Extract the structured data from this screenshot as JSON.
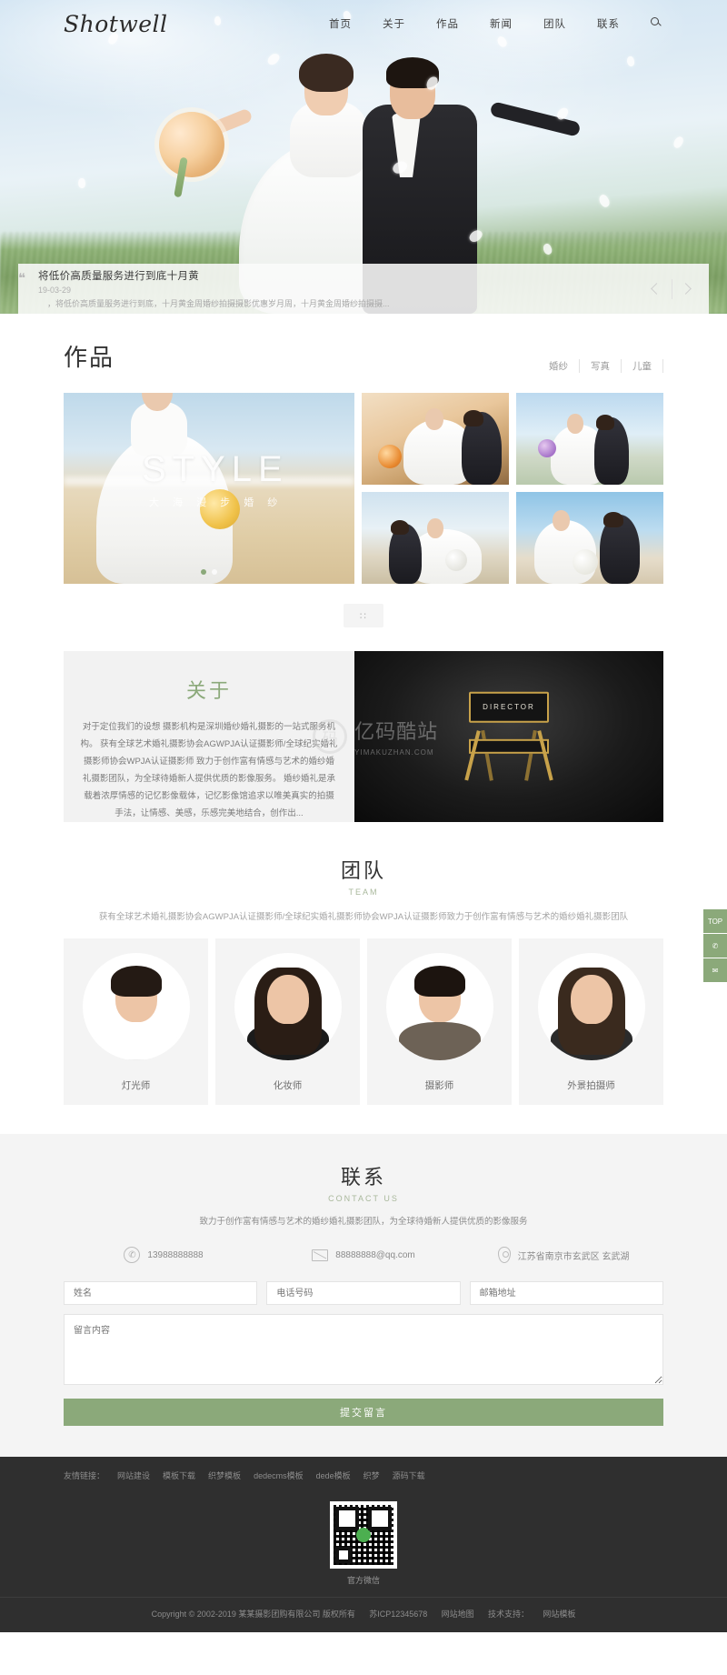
{
  "header": {
    "logo": "Shotwell",
    "nav": [
      {
        "label": "首页"
      },
      {
        "label": "关于"
      },
      {
        "label": "作品"
      },
      {
        "label": "新闻"
      },
      {
        "label": "团队"
      },
      {
        "label": "联系"
      }
    ],
    "search_icon": "search-icon"
  },
  "news": {
    "quote_mark": "❝",
    "title": "将低价高质量服务进行到底十月黄",
    "date": "19-03-29",
    "desc": "，将低价高质量服务进行到底，十月黄金周婚纱拍摄摄影优惠岁月周，十月黄金周婚纱拍摄摄...",
    "prev_label": "‹",
    "next_label": "›"
  },
  "works": {
    "title": "作品",
    "filters": [
      {
        "label": "婚纱"
      },
      {
        "label": "写真"
      },
      {
        "label": "儿童"
      }
    ],
    "slide_title": "STYLE",
    "slide_sub": "大 海 漫 步 婚 纱",
    "load_more": "∷"
  },
  "about": {
    "title": "关于",
    "text": "对于定位我们的设想 摄影机构是深圳婚纱婚礼摄影的一站式服务机构。 获有全球艺术婚礼摄影协会AGWPJA认证摄影师/全球纪实婚礼摄影师协会WPJA认证摄影师 致力于创作富有情感与艺术的婚纱婚礼摄影团队，为全球待婚新人提供优质的影像服务。 婚纱婚礼是承载着浓厚情感的记忆影像载体，记忆影像馆追求以唯美真实的拍摄手法，让情感、美感，乐感完美地结合，创作出...",
    "image_caption": "DIRECTOR",
    "watermark_main": "亿码酷站",
    "watermark_sub": "YIMAKUZHAN.COM"
  },
  "team": {
    "title": "团队",
    "subtitle": "TEAM",
    "desc": "获有全球艺术婚礼摄影协会AGWPJA认证摄影师/全球纪实婚礼摄影师协会WPJA认证摄影师致力于创作富有情感与艺术的婚纱婚礼摄影团队",
    "members": [
      {
        "name": "灯光师"
      },
      {
        "name": "化妆师"
      },
      {
        "name": "摄影师"
      },
      {
        "name": "外景拍摄师"
      }
    ]
  },
  "contact": {
    "title": "联系",
    "subtitle": "CONTACT US",
    "desc": "致力于创作富有情感与艺术的婚纱婚礼摄影团队，为全球待婚新人提供优质的影像服务",
    "phone": "13988888888",
    "email": "88888888@qq.com",
    "address": "江苏省南京市玄武区 玄武湖",
    "form": {
      "name_placeholder": "姓名",
      "tel_placeholder": "电话号码",
      "email_placeholder": "邮箱地址",
      "message_placeholder": "留言内容",
      "submit_label": "提交留言"
    }
  },
  "footer": {
    "links": [
      {
        "label": "友情链接："
      },
      {
        "label": "网站建设"
      },
      {
        "label": "模板下载"
      },
      {
        "label": "织梦模板"
      },
      {
        "label": "dedecms模板"
      },
      {
        "label": "dede模板"
      },
      {
        "label": "织梦"
      },
      {
        "label": "源码下载"
      }
    ],
    "qr_caption": "官方微信",
    "copyright": "Copyright © 2002-2019 某某摄影团购有限公司 版权所有",
    "icp": "苏ICP12345678",
    "sitemap": "网站地图",
    "support_label": "技术支持：",
    "support_value": "网站模板"
  },
  "dock": [
    {
      "label": "TOP"
    },
    {
      "label": "✆"
    },
    {
      "label": "✉"
    }
  ],
  "colors": {
    "accent": "#8ba97a",
    "dark": "#2f2f2f",
    "muted": "#a3a3a3"
  }
}
